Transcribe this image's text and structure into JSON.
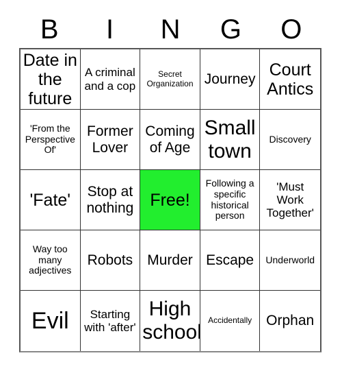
{
  "header": {
    "letters": [
      "B",
      "I",
      "N",
      "G",
      "O"
    ]
  },
  "board": {
    "free_cell_color": "#22ee2e",
    "border_color": "#333333",
    "background_color": "#ffffff",
    "text_color": "#000000",
    "rows": 5,
    "columns": 5,
    "cells": [
      {
        "text": "Date in the future",
        "size": "lg",
        "free": false
      },
      {
        "text": "A criminal and a cop",
        "size": "sm",
        "free": false
      },
      {
        "text": "Secret Organization",
        "size": "xxs",
        "free": false
      },
      {
        "text": "Journey",
        "size": "md",
        "free": false
      },
      {
        "text": "Court Antics",
        "size": "lg",
        "free": false
      },
      {
        "text": "'From the Perspective Of'",
        "size": "xs",
        "free": false
      },
      {
        "text": "Former Lover",
        "size": "md",
        "free": false
      },
      {
        "text": "Coming of Age",
        "size": "md",
        "free": false
      },
      {
        "text": "Small town",
        "size": "xl",
        "free": false
      },
      {
        "text": "Discovery",
        "size": "xs",
        "free": false
      },
      {
        "text": "'Fate'",
        "size": "lg",
        "free": false
      },
      {
        "text": "Stop at nothing",
        "size": "md",
        "free": false
      },
      {
        "text": "Free!",
        "size": "lg",
        "free": true
      },
      {
        "text": "Following a specific historical person",
        "size": "xs",
        "free": false
      },
      {
        "text": "'Must Work Together'",
        "size": "sm",
        "free": false
      },
      {
        "text": "Way too many adjectives",
        "size": "xs",
        "free": false
      },
      {
        "text": "Robots",
        "size": "md",
        "free": false
      },
      {
        "text": "Murder",
        "size": "md",
        "free": false
      },
      {
        "text": "Escape",
        "size": "md",
        "free": false
      },
      {
        "text": "Underworld",
        "size": "xs",
        "free": false
      },
      {
        "text": "Evil",
        "size": "xxl",
        "free": false
      },
      {
        "text": "Starting with 'after'",
        "size": "sm",
        "free": false
      },
      {
        "text": "High school",
        "size": "xl",
        "free": false
      },
      {
        "text": "Accidentally",
        "size": "xxs",
        "free": false
      },
      {
        "text": "Orphan",
        "size": "md",
        "free": false
      }
    ]
  }
}
